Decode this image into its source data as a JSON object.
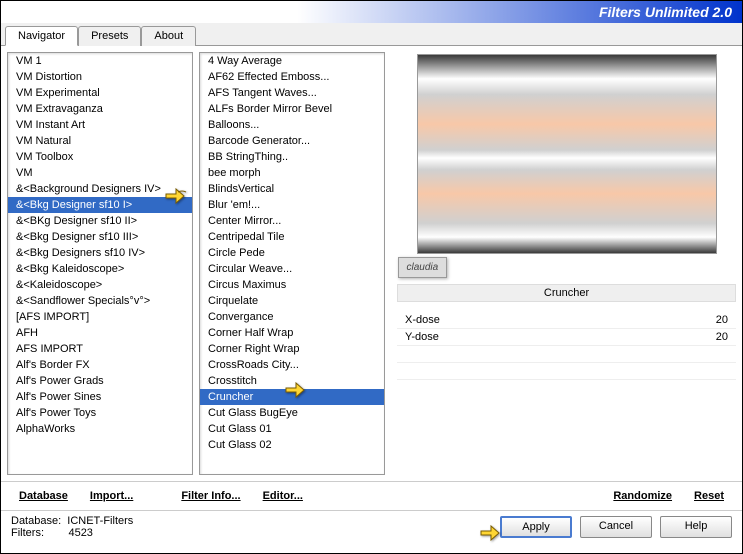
{
  "title": "Filters Unlimited 2.0",
  "tabs": [
    {
      "label": "Navigator",
      "active": true
    },
    {
      "label": "Presets",
      "active": false
    },
    {
      "label": "About",
      "active": false
    }
  ],
  "categories": [
    "VM 1",
    "VM Distortion",
    "VM Experimental",
    "VM Extravaganza",
    "VM Instant Art",
    "VM Natural",
    "VM Toolbox",
    "VM",
    "&<Background Designers IV>",
    "&<Bkg Designer sf10 I>",
    "&<BKg Designer sf10 II>",
    "&<Bkg Designer sf10 III>",
    "&<Bkg Designers sf10 IV>",
    "&<Bkg Kaleidoscope>",
    "&<Kaleidoscope>",
    "&<Sandflower Specials°v°>",
    "[AFS IMPORT]",
    "AFH",
    "AFS IMPORT",
    "Alf's Border FX",
    "Alf's Power Grads",
    "Alf's Power Sines",
    "Alf's Power Toys",
    "AlphaWorks"
  ],
  "categories_selected_index": 9,
  "filters": [
    "4 Way Average",
    "AF62 Effected Emboss...",
    "AFS Tangent Waves...",
    "ALFs Border Mirror Bevel",
    "Balloons...",
    "Barcode Generator...",
    "BB StringThing..",
    "bee morph",
    "BlindsVertical",
    "Blur 'em!...",
    "Center Mirror...",
    "Centripedal Tile",
    "Circle Pede",
    "Circular Weave...",
    "Circus Maximus",
    "Cirquelate",
    "Convergance",
    "Corner Half Wrap",
    "Corner Right Wrap",
    "CrossRoads City...",
    "Crosstitch",
    "Cruncher",
    "Cut Glass  BugEye",
    "Cut Glass 01",
    "Cut Glass 02"
  ],
  "filters_selected_index": 21,
  "badge_text": "claudia",
  "filter_name": "Cruncher",
  "params": [
    {
      "name": "X-dose",
      "value": 20
    },
    {
      "name": "Y-dose",
      "value": 20
    }
  ],
  "toolbar": {
    "database": "Database",
    "import": "Import...",
    "filter_info": "Filter Info...",
    "editor": "Editor...",
    "randomize": "Randomize",
    "reset": "Reset"
  },
  "status": {
    "db_label": "Database:",
    "db_value": "ICNET-Filters",
    "filters_label": "Filters:",
    "filters_value": "4523"
  },
  "buttons": {
    "apply": "Apply",
    "cancel": "Cancel",
    "help": "Help"
  }
}
